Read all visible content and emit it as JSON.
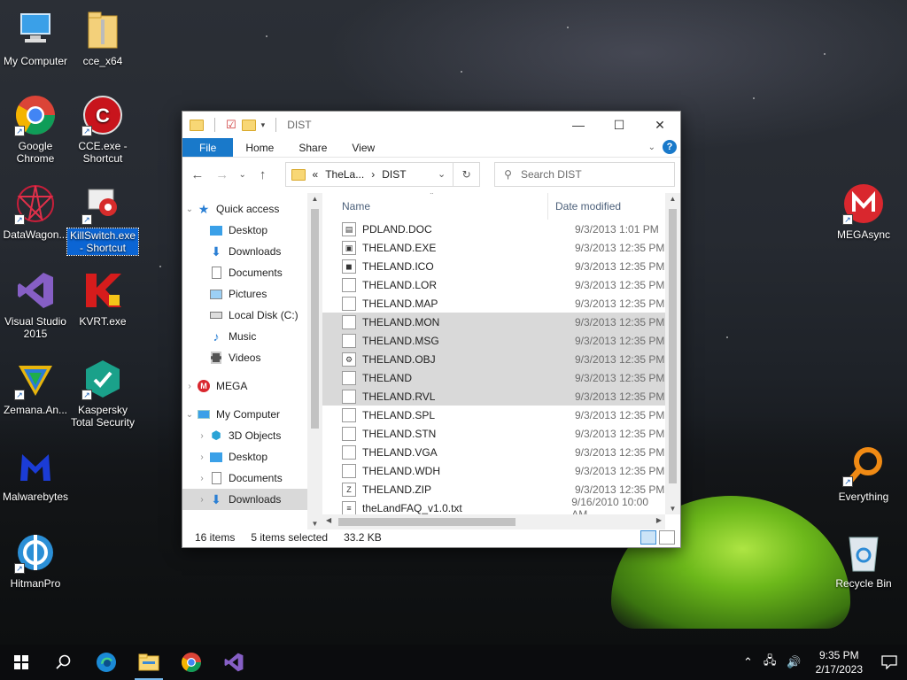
{
  "desktop": {
    "icons": [
      {
        "label": "My Computer"
      },
      {
        "label": "cce_x64"
      },
      {
        "label": "Google Chrome"
      },
      {
        "label": "CCE.exe - Shortcut"
      },
      {
        "label": "DataWagon..."
      },
      {
        "label": "KillSwitch.exe - Shortcut"
      },
      {
        "label": "Visual Studio 2015"
      },
      {
        "label": "KVRT.exe"
      },
      {
        "label": "Zemana.An..."
      },
      {
        "label": "Kaspersky Total Security"
      },
      {
        "label": "Malwarebytes"
      },
      {
        "label": "HitmanPro"
      },
      {
        "label": "MEGAsync"
      },
      {
        "label": "Everything"
      },
      {
        "label": "Recycle Bin"
      }
    ]
  },
  "explorer": {
    "title": "DIST",
    "ribbon": {
      "file": "File",
      "home": "Home",
      "share": "Share",
      "view": "View"
    },
    "address": {
      "prefix": "«",
      "seg1": "TheLa...",
      "sep": "›",
      "seg2": "DIST"
    },
    "search_placeholder": "Search DIST",
    "nav": {
      "quick_access": "Quick access",
      "desktop": "Desktop",
      "downloads": "Downloads",
      "documents": "Documents",
      "pictures": "Pictures",
      "local_disk": "Local Disk (C:)",
      "music": "Music",
      "videos": "Videos",
      "mega": "MEGA",
      "my_computer": "My Computer",
      "objects3d": "3D Objects",
      "desktop2": "Desktop",
      "documents2": "Documents",
      "downloads2": "Downloads"
    },
    "columns": {
      "name": "Name",
      "date": "Date modified"
    },
    "files": [
      {
        "name": "PDLAND.DOC",
        "date": "9/3/2013 1:01 PM",
        "selected": false
      },
      {
        "name": "THELAND.EXE",
        "date": "9/3/2013 12:35 PM",
        "selected": false
      },
      {
        "name": "THELAND.ICO",
        "date": "9/3/2013 12:35 PM",
        "selected": false
      },
      {
        "name": "THELAND.LOR",
        "date": "9/3/2013 12:35 PM",
        "selected": false
      },
      {
        "name": "THELAND.MAP",
        "date": "9/3/2013 12:35 PM",
        "selected": false
      },
      {
        "name": "THELAND.MON",
        "date": "9/3/2013 12:35 PM",
        "selected": true
      },
      {
        "name": "THELAND.MSG",
        "date": "9/3/2013 12:35 PM",
        "selected": true
      },
      {
        "name": "THELAND.OBJ",
        "date": "9/3/2013 12:35 PM",
        "selected": true
      },
      {
        "name": "THELAND",
        "date": "9/3/2013 12:35 PM",
        "selected": true
      },
      {
        "name": "THELAND.RVL",
        "date": "9/3/2013 12:35 PM",
        "selected": true
      },
      {
        "name": "THELAND.SPL",
        "date": "9/3/2013 12:35 PM",
        "selected": false
      },
      {
        "name": "THELAND.STN",
        "date": "9/3/2013 12:35 PM",
        "selected": false
      },
      {
        "name": "THELAND.VGA",
        "date": "9/3/2013 12:35 PM",
        "selected": false
      },
      {
        "name": "THELAND.WDH",
        "date": "9/3/2013 12:35 PM",
        "selected": false
      },
      {
        "name": "THELAND.ZIP",
        "date": "9/3/2013 12:35 PM",
        "selected": false
      },
      {
        "name": "theLandFAQ_v1.0.txt",
        "date": "9/16/2010 10:00 AM",
        "selected": false
      }
    ],
    "status": {
      "count": "16 items",
      "selected": "5 items selected",
      "size": "33.2 KB"
    }
  },
  "taskbar": {
    "time": "9:35 PM",
    "date": "2/17/2023"
  },
  "colors": {
    "accent": "#1979ca",
    "selection_row": "#d9d9d9",
    "desktop_label_selected": "#0b65d4"
  }
}
